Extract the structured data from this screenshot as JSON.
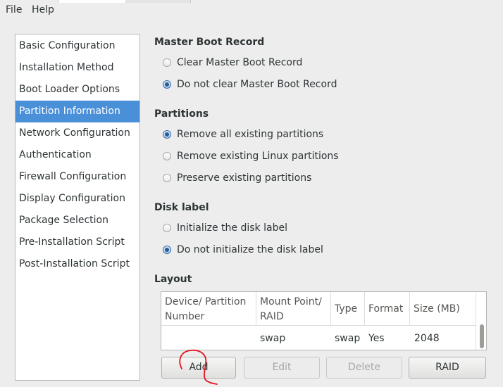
{
  "menu": {
    "file": "File",
    "help": "Help"
  },
  "sidebar": {
    "items": [
      {
        "label": "Basic Configuration",
        "selected": false
      },
      {
        "label": "Installation Method",
        "selected": false
      },
      {
        "label": "Boot Loader Options",
        "selected": false
      },
      {
        "label": "Partition Information",
        "selected": true
      },
      {
        "label": "Network Configuration",
        "selected": false
      },
      {
        "label": "Authentication",
        "selected": false
      },
      {
        "label": "Firewall Configuration",
        "selected": false
      },
      {
        "label": "Display Configuration",
        "selected": false
      },
      {
        "label": "Package Selection",
        "selected": false
      },
      {
        "label": "Pre-Installation Script",
        "selected": false
      },
      {
        "label": "Post-Installation Script",
        "selected": false
      }
    ]
  },
  "mbr": {
    "title": "Master Boot Record",
    "options": [
      {
        "label": "Clear Master Boot Record",
        "checked": false
      },
      {
        "label": "Do not clear Master Boot Record",
        "checked": true
      }
    ]
  },
  "partitions": {
    "title": "Partitions",
    "options": [
      {
        "label": "Remove all existing partitions",
        "checked": true
      },
      {
        "label": "Remove existing Linux partitions",
        "checked": false
      },
      {
        "label": "Preserve existing partitions",
        "checked": false
      }
    ]
  },
  "disk_label": {
    "title": "Disk label",
    "options": [
      {
        "label": "Initialize the disk label",
        "checked": false
      },
      {
        "label": "Do not initialize the disk label",
        "checked": true
      }
    ]
  },
  "layout": {
    "title": "Layout",
    "columns": [
      "Device/ Partition Number",
      "Mount Point/ RAID",
      "Type",
      "Format",
      "Size (MB)"
    ],
    "rows": [
      {
        "device": "",
        "mount": "swap",
        "type": "swap",
        "format": "Yes",
        "size": "2048"
      }
    ]
  },
  "buttons": {
    "add": "Add",
    "edit": "Edit",
    "delete": "Delete",
    "raid": "RAID"
  },
  "colors": {
    "selection": "#4a90d9",
    "annotation": "#e0141e"
  }
}
